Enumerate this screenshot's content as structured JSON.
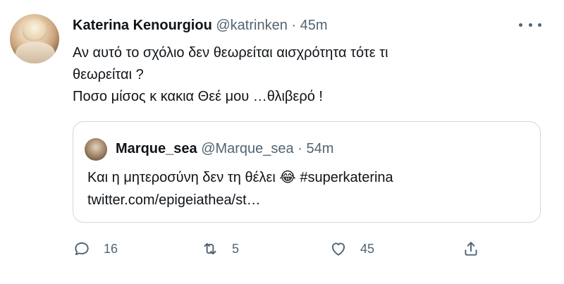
{
  "tweet": {
    "author_name": "Katerina Kenourgiou",
    "author_handle": "@katrinken",
    "separator": "·",
    "time": "45m",
    "text_lines": [
      "Αν αυτό το σχόλιο δεν θεωρείται αισχρότητα τότε τι",
      "θεωρείται ?",
      "Ποσο μίσος κ κακια Θεέ μου …θλιβερό !"
    ]
  },
  "quoted": {
    "author_name": "Marque_sea",
    "author_handle": "@Marque_sea",
    "separator": "·",
    "time": "54m",
    "text_line1": "Και η μητεροσύνη δεν τη θέλει",
    "emoji": "😂",
    "hashtag": "#superkaterina",
    "link": "twitter.com/epigeiathea/st…"
  },
  "actions": {
    "reply_count": "16",
    "retweet_count": "5",
    "like_count": "45"
  },
  "icons": {
    "reply": "reply-icon",
    "retweet": "retweet-icon",
    "like": "heart-icon",
    "share": "share-icon",
    "more": "more-icon"
  },
  "colors": {
    "text": "#0f1419",
    "secondary": "#536471",
    "border": "#cfd9de"
  }
}
